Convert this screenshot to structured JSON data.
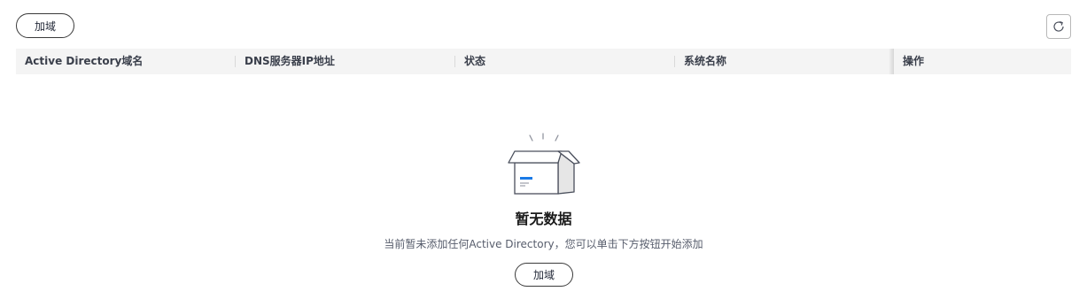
{
  "toolbar": {
    "add_label": "加域",
    "refresh_icon": "refresh-icon"
  },
  "table": {
    "columns": [
      "Active Directory域名",
      "DNS服务器IP地址",
      "状态",
      "系统名称",
      "操作"
    ]
  },
  "empty_state": {
    "icon": "empty-box-icon",
    "title": "暂无数据",
    "description": "当前暂未添加任何Active Directory，您可以单击下方按钮开始添加",
    "add_label": "加域"
  },
  "colors": {
    "header_background": "#f4f4f4",
    "accent": "#1a7ae6",
    "button_border": "#3a3a3a"
  }
}
